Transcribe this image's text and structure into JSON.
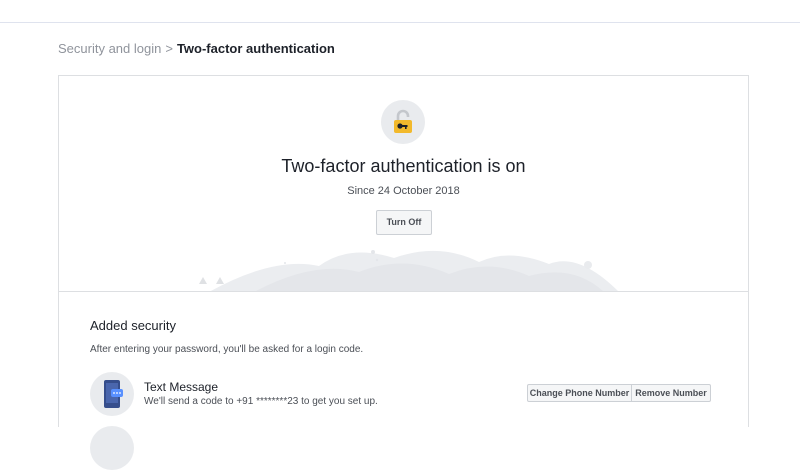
{
  "breadcrumb": {
    "parent": "Security and login",
    "separator": ">",
    "current": "Two-factor authentication"
  },
  "status": {
    "icon": "unlocked-padlock-with-key-icon",
    "title": "Two-factor authentication is on",
    "since": "Since 24 October 2018",
    "turn_off_label": "Turn Off"
  },
  "added_security": {
    "title": "Added security",
    "description": "After entering your password, you'll be asked for a login code.",
    "methods": [
      {
        "icon": "phone-message-icon",
        "title": "Text Message",
        "description": "We'll send a code to +91 ********23 to get you set up.",
        "change_label": "Change Phone Number",
        "remove_label": "Remove Number"
      }
    ]
  },
  "colors": {
    "lock_accent": "#f2b92c",
    "border": "#dddfe2",
    "muted_text": "#90949c"
  }
}
